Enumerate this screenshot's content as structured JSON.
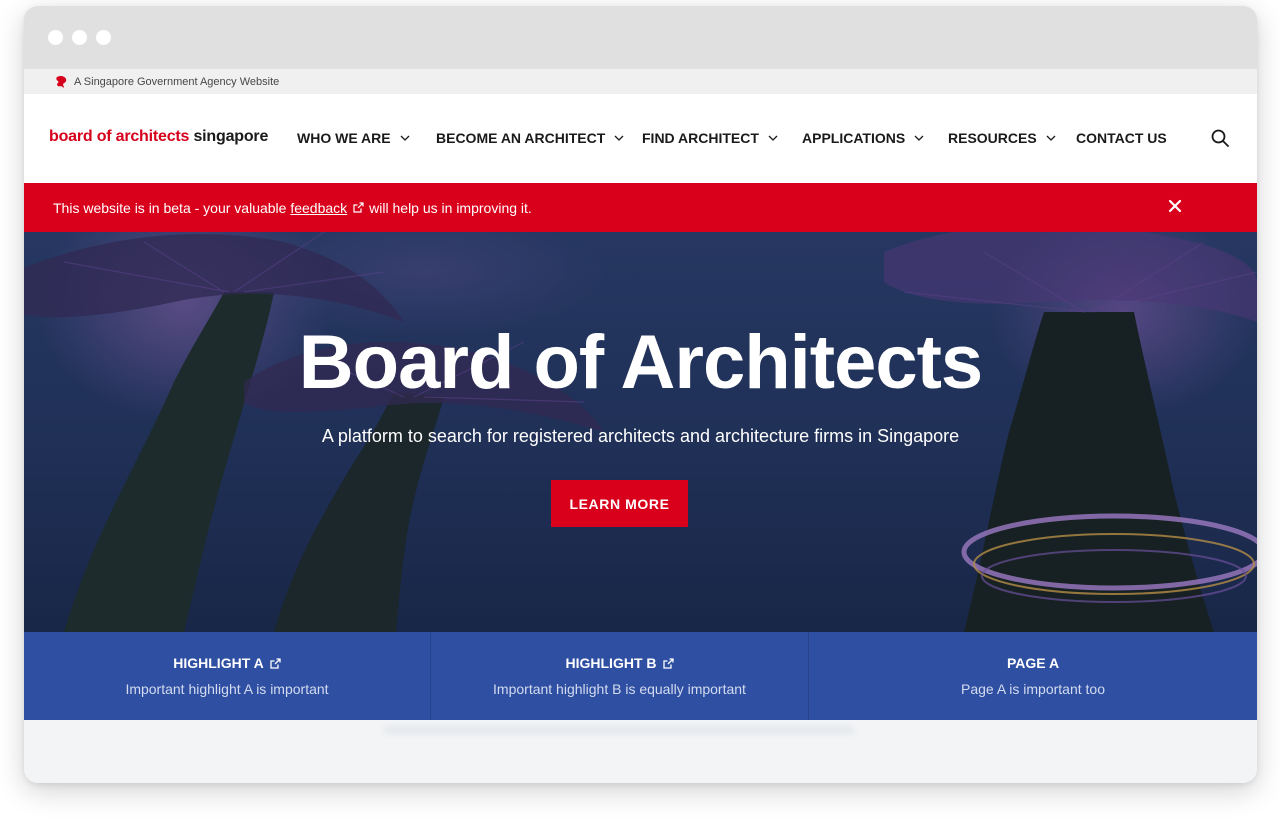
{
  "masthead": {
    "text": "A Singapore Government Agency Website",
    "icon": "lion-head-icon"
  },
  "navbar": {
    "logo_part1": "board of architects",
    "logo_part2": "singapore",
    "items": [
      {
        "label": "WHO WE ARE",
        "has_dropdown": true
      },
      {
        "label": "BECOME AN ARCHITECT",
        "has_dropdown": true
      },
      {
        "label": "FIND ARCHITECT",
        "has_dropdown": true
      },
      {
        "label": "APPLICATIONS",
        "has_dropdown": true
      },
      {
        "label": "RESOURCES",
        "has_dropdown": true
      },
      {
        "label": "CONTACT US",
        "has_dropdown": false
      }
    ],
    "search_icon": "search-icon"
  },
  "beta_banner": {
    "text_before": "This website is in beta - your valuable",
    "link_text": "feedback",
    "text_after": "will help us in improving it.",
    "close_icon": "close-icon"
  },
  "hero": {
    "title": "Board of Architects",
    "subtitle": "A platform to search for registered architects and architecture firms in Singapore",
    "button_label": "LEARN MORE"
  },
  "highlights": [
    {
      "title": "HIGHLIGHT A",
      "description": "Important highlight A is important",
      "external": true
    },
    {
      "title": "HIGHLIGHT B",
      "description": "Important highlight B is equally important",
      "external": true
    },
    {
      "title": "PAGE A",
      "description": "Page A is important too",
      "external": false
    }
  ],
  "colors": {
    "brand_red": "#d9001b",
    "highlight_blue": "#2f4fa2",
    "text_dark": "#1a1a1a"
  }
}
